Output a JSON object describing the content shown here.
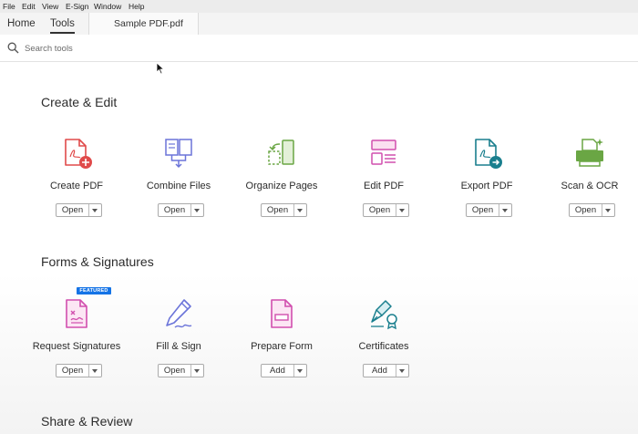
{
  "menu": [
    "File",
    "Edit",
    "View",
    "E-Sign",
    "Window",
    "Help"
  ],
  "tabs": {
    "home": "Home",
    "tools": "Tools",
    "document": "Sample PDF.pdf"
  },
  "search": {
    "placeholder": "Search tools"
  },
  "sections": [
    {
      "title": "Create & Edit",
      "tools": [
        {
          "label": "Create PDF",
          "button": "Open",
          "icon": "create-pdf-icon"
        },
        {
          "label": "Combine Files",
          "button": "Open",
          "icon": "combine-files-icon"
        },
        {
          "label": "Organize Pages",
          "button": "Open",
          "icon": "organize-pages-icon"
        },
        {
          "label": "Edit PDF",
          "button": "Open",
          "icon": "edit-pdf-icon"
        },
        {
          "label": "Export PDF",
          "button": "Open",
          "icon": "export-pdf-icon"
        },
        {
          "label": "Scan & OCR",
          "button": "Open",
          "icon": "scan-ocr-icon"
        }
      ]
    },
    {
      "title": "Forms & Signatures",
      "badge": "FEATURED",
      "tools": [
        {
          "label": "Request Signatures",
          "button": "Open",
          "icon": "request-signatures-icon"
        },
        {
          "label": "Fill & Sign",
          "button": "Open",
          "icon": "fill-sign-icon"
        },
        {
          "label": "Prepare Form",
          "button": "Add",
          "icon": "prepare-form-icon"
        },
        {
          "label": "Certificates",
          "button": "Add",
          "icon": "certificates-icon"
        }
      ]
    },
    {
      "title": "Share & Review"
    }
  ],
  "colors": {
    "red": "#e04a4a",
    "blue": "#6b74d9",
    "green": "#6aa644",
    "pink": "#d14fae",
    "teal": "#1a7f8e",
    "featured_badge": "#1473e6"
  }
}
